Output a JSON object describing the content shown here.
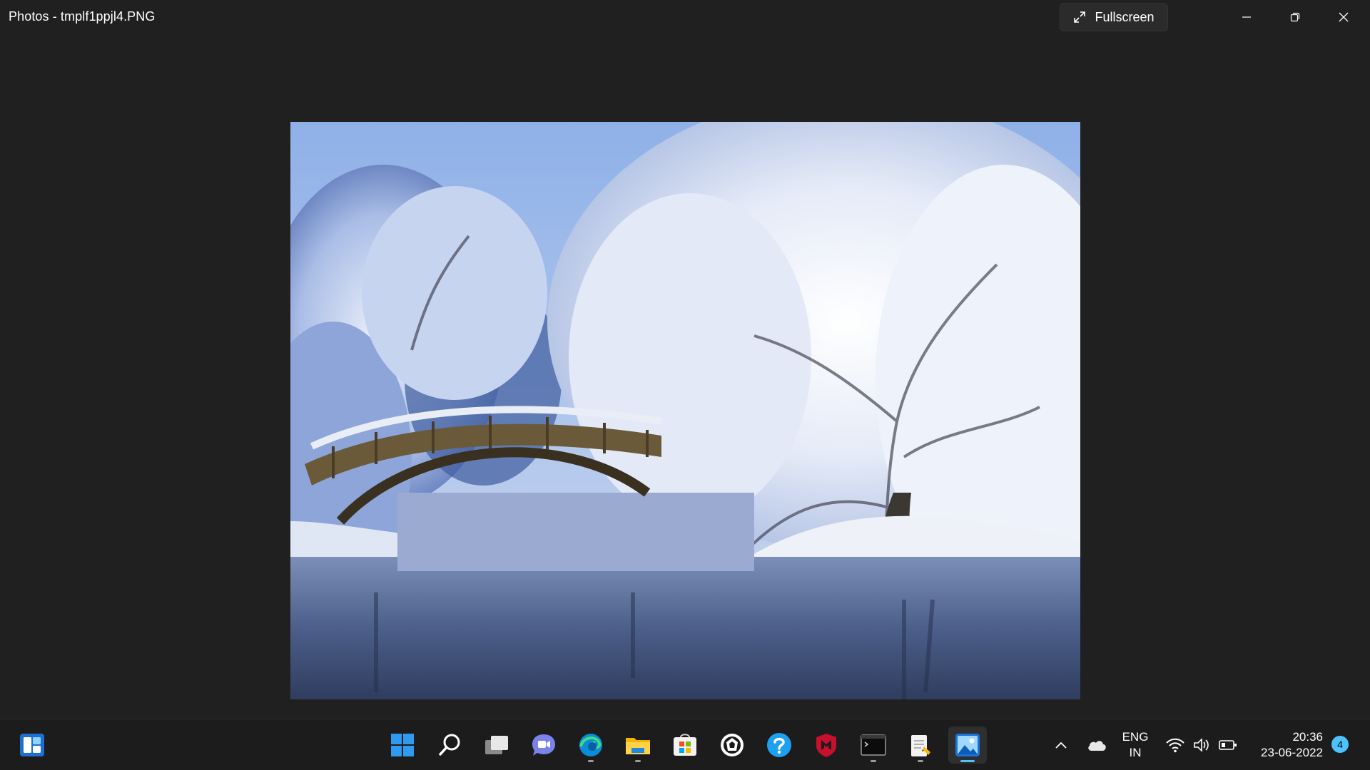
{
  "window": {
    "title": "Photos - tmplf1ppjl4.PNG",
    "fullscreen_label": "Fullscreen"
  },
  "photo": {
    "description": "snowy park with arched wooden bridge over a lake"
  },
  "taskbar": {
    "apps": [
      {
        "name": "widgets",
        "icon": "widgets-icon"
      },
      {
        "name": "start",
        "icon": "windows-start-icon"
      },
      {
        "name": "search",
        "icon": "search-icon"
      },
      {
        "name": "task view",
        "icon": "task-view-icon"
      },
      {
        "name": "chat",
        "icon": "teams-chat-icon"
      },
      {
        "name": "edge",
        "icon": "edge-icon"
      },
      {
        "name": "file explorer",
        "icon": "folder-icon"
      },
      {
        "name": "microsoft store",
        "icon": "store-icon"
      },
      {
        "name": "unknown app",
        "icon": "app-icon"
      },
      {
        "name": "get help",
        "icon": "help-icon"
      },
      {
        "name": "mcafee",
        "icon": "mcafee-icon"
      },
      {
        "name": "terminal",
        "icon": "terminal-icon"
      },
      {
        "name": "notepad",
        "icon": "notepad-icon"
      },
      {
        "name": "photos",
        "icon": "photos-icon"
      }
    ],
    "tray": {
      "language_top": "ENG",
      "language_bottom": "IN",
      "time": "20:36",
      "date": "23-06-2022",
      "notification_count": "4"
    }
  },
  "colors": {
    "accent": "#4cc2ff",
    "background": "#202020",
    "taskbar": "#1c1c1c"
  }
}
